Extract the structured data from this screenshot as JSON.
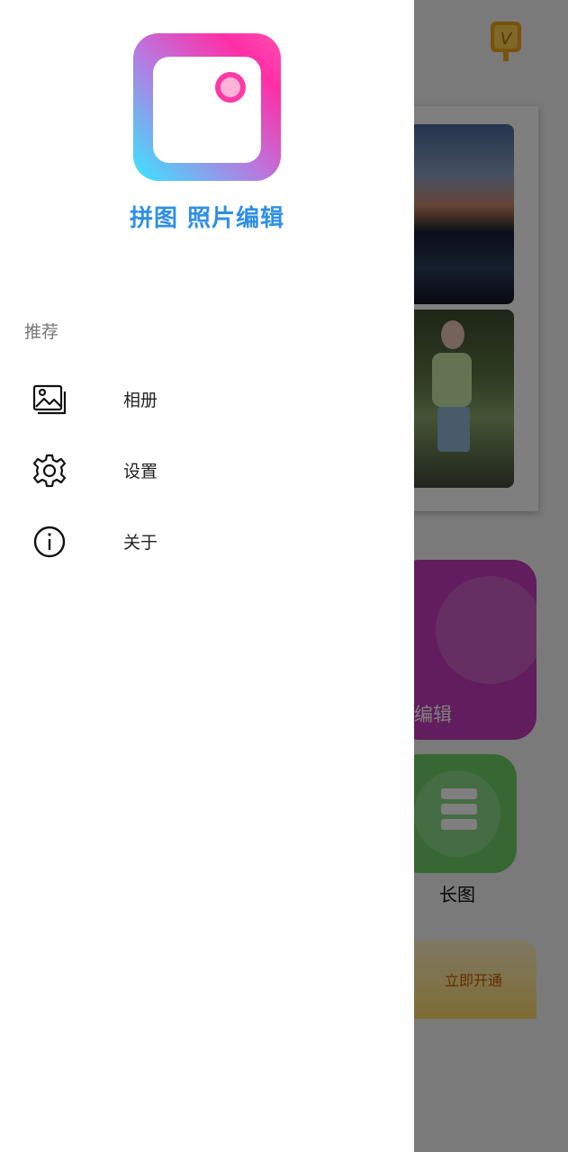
{
  "app": {
    "title": "拼图 照片编辑",
    "logo_icon": "collage-app-logo-icon"
  },
  "drawer": {
    "section_label": "推荐",
    "items": [
      {
        "label": "相册",
        "icon": "gallery-icon"
      },
      {
        "label": "设置",
        "icon": "gear-icon"
      },
      {
        "label": "关于",
        "icon": "info-icon"
      }
    ]
  },
  "background": {
    "vip_icon": "vip-badge-icon",
    "edit_tile_label": "编辑",
    "long_image_label": "长图",
    "banner_button_label": "立即开通"
  },
  "colors": {
    "title_blue": "#2f8fe6",
    "scrim": "rgba(0,0,0,0.5)",
    "edit_tile": "#c23bbd",
    "long_tile": "#6ed168"
  }
}
